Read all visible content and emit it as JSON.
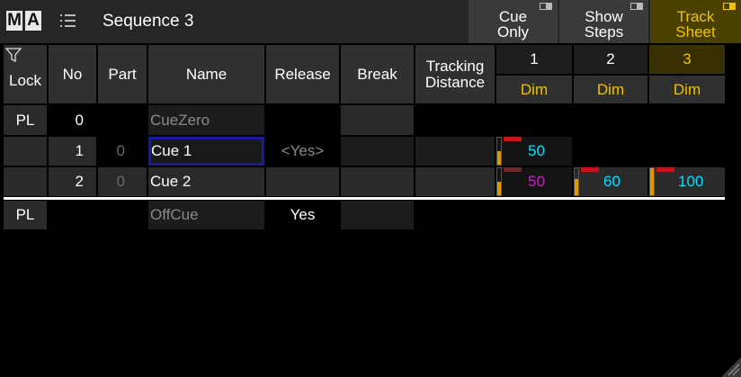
{
  "window": {
    "logo_m": "M",
    "logo_a": "A",
    "title": "Sequence 3",
    "buttons": {
      "cue_only": {
        "line1": "Cue",
        "line2": "Only"
      },
      "show_steps": {
        "line1": "Show",
        "line2": "Steps"
      },
      "track_sheet": {
        "line1": "Track",
        "line2": "Sheet"
      }
    }
  },
  "columns": {
    "lock": "Lock",
    "no": "No",
    "part": "Part",
    "name": "Name",
    "release": "Release",
    "break": "Break",
    "tracking_line1": "Tracking",
    "tracking_line2": "Distance",
    "fixtures": [
      {
        "id": "1",
        "attr": "Dim"
      },
      {
        "id": "2",
        "attr": "Dim"
      },
      {
        "id": "3",
        "attr": "Dim"
      }
    ]
  },
  "rows": {
    "cue_zero": {
      "lock": "PL",
      "no": "0",
      "name": "CueZero"
    },
    "cue1": {
      "no": "1",
      "part": "0",
      "name": "Cue  1",
      "release": "<Yes>",
      "values": [
        "50"
      ]
    },
    "cue2": {
      "no": "2",
      "part": "0",
      "name": "Cue  2",
      "values": [
        "50",
        "60",
        "100"
      ]
    },
    "off_cue": {
      "lock": "PL",
      "name": "OffCue",
      "release": "Yes"
    }
  },
  "levels": {
    "cue1_f1": 0.5,
    "cue2_f1": 0.5,
    "cue2_f2": 0.6,
    "cue2_f3": 1.0
  },
  "colors": {
    "accent_yellow": "#f2c200",
    "value_cyan": "#00e0ff",
    "value_magenta": "#c020c0",
    "selection_blue": "#1a1aa0",
    "level_bar": "#e09a00",
    "level_marker": "#c8141c"
  },
  "icons": [
    "filter-icon",
    "list-icon",
    "resize-grip-icon"
  ]
}
